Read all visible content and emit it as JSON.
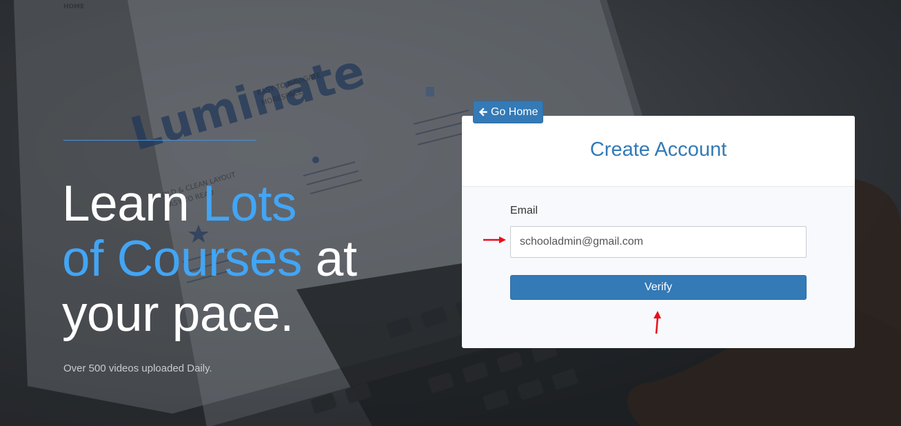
{
  "hero": {
    "line1_white": "Learn ",
    "line1_accent": "Lots",
    "line2_accent": "of Courses",
    "line2_white": " at",
    "line3_white": "your pace.",
    "subtitle": "Over 500 videos uploaded Daily."
  },
  "nav": {
    "go_home_label": "Go Home"
  },
  "form": {
    "title": "Create Account",
    "email_label": "Email",
    "email_value": "schooladmin@gmail.com",
    "submit_label": "Verify"
  },
  "background": {
    "screen_words": [
      "HOME",
      "Luminate",
      "EASY TO NAVIGATE",
      "MORESPACE",
      "BOLD & CLEAN LAYOUT",
      "EASY TO READ"
    ]
  },
  "colors": {
    "accent": "#42a5f5",
    "primary_button": "#337ab7",
    "annotation": "#e8101a"
  }
}
